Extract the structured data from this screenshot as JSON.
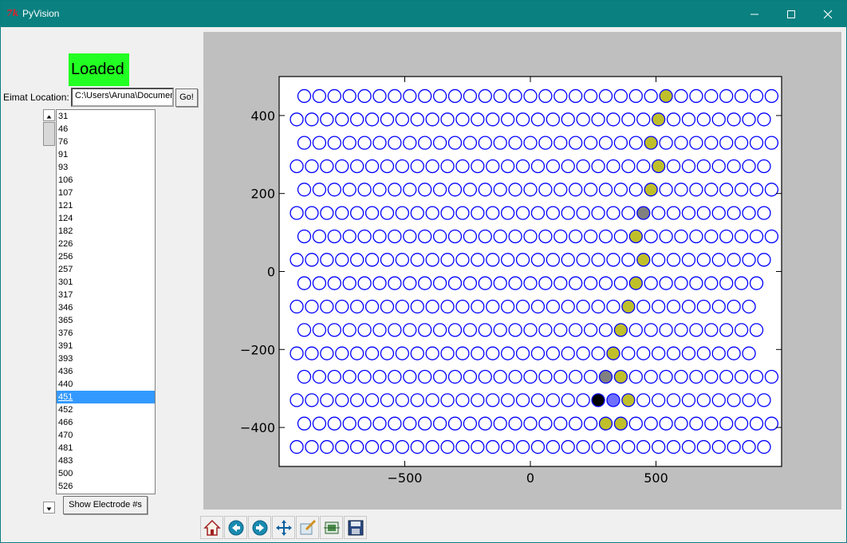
{
  "window": {
    "title": "PyVision",
    "icon": "tk-feather-icon"
  },
  "status": {
    "text": "Loaded",
    "color": "#22ff22"
  },
  "eimat": {
    "label": "Eimat Location:",
    "value": "C:\\Users\\Aruna\\Documents",
    "go_label": "Go!"
  },
  "electrode_list": {
    "items": [
      "31",
      "46",
      "76",
      "91",
      "93",
      "106",
      "107",
      "121",
      "124",
      "182",
      "226",
      "256",
      "257",
      "301",
      "317",
      "346",
      "365",
      "376",
      "391",
      "393",
      "436",
      "440",
      "451",
      "452",
      "466",
      "470",
      "481",
      "483",
      "500",
      "526"
    ],
    "selected": "451"
  },
  "show_button": {
    "label": "Show Electrode #s"
  },
  "chart_data": {
    "type": "scatter",
    "xlim": [
      -1000,
      1000
    ],
    "ylim": [
      -500,
      500
    ],
    "xticks": [
      -500,
      0,
      500
    ],
    "yticks": [
      400,
      200,
      0,
      -200,
      -400
    ],
    "xtick_labels": [
      "−500",
      "0",
      "500"
    ],
    "ytick_labels": [
      "400",
      "200",
      "0",
      "−200",
      "−400"
    ],
    "grid": false,
    "marker_edge_color": "#0000ff",
    "highlight_colors": {
      "olive": "#bfbf2a",
      "gray": "#808080",
      "black": "#000000",
      "blue": "#7070ff"
    },
    "rows": [
      {
        "y": 450,
        "x_start": -900,
        "count": 32
      },
      {
        "y": 390,
        "x_start": -930,
        "count": 32
      },
      {
        "y": 330,
        "x_start": -900,
        "count": 32
      },
      {
        "y": 270,
        "x_start": -930,
        "count": 32
      },
      {
        "y": 210,
        "x_start": -900,
        "count": 32
      },
      {
        "y": 150,
        "x_start": -930,
        "count": 32
      },
      {
        "y": 90,
        "x_start": -900,
        "count": 32
      },
      {
        "y": 30,
        "x_start": -930,
        "count": 32
      },
      {
        "y": -30,
        "x_start": -900,
        "count": 31
      },
      {
        "y": -90,
        "x_start": -930,
        "count": 31
      },
      {
        "y": -150,
        "x_start": -900,
        "count": 31
      },
      {
        "y": -210,
        "x_start": -930,
        "count": 31
      },
      {
        "y": -270,
        "x_start": -900,
        "count": 32
      },
      {
        "y": -330,
        "x_start": -930,
        "count": 32
      },
      {
        "y": -390,
        "x_start": -900,
        "count": 32
      },
      {
        "y": -450,
        "x_start": -930,
        "count": 32
      }
    ],
    "x_step": 60,
    "highlighted": [
      {
        "x": 540,
        "y": 450,
        "fill": "olive"
      },
      {
        "x": 510,
        "y": 390,
        "fill": "olive"
      },
      {
        "x": 480,
        "y": 330,
        "fill": "olive"
      },
      {
        "x": 510,
        "y": 270,
        "fill": "olive"
      },
      {
        "x": 480,
        "y": 210,
        "fill": "olive"
      },
      {
        "x": 450,
        "y": 150,
        "fill": "gray"
      },
      {
        "x": 420,
        "y": 90,
        "fill": "olive"
      },
      {
        "x": 450,
        "y": 30,
        "fill": "olive"
      },
      {
        "x": 420,
        "y": -30,
        "fill": "olive"
      },
      {
        "x": 390,
        "y": -90,
        "fill": "olive"
      },
      {
        "x": 360,
        "y": -150,
        "fill": "olive"
      },
      {
        "x": 330,
        "y": -210,
        "fill": "olive"
      },
      {
        "x": 300,
        "y": -270,
        "fill": "gray"
      },
      {
        "x": 360,
        "y": -270,
        "fill": "olive"
      },
      {
        "x": 270,
        "y": -330,
        "fill": "black"
      },
      {
        "x": 330,
        "y": -330,
        "fill": "blue"
      },
      {
        "x": 390,
        "y": -330,
        "fill": "olive"
      },
      {
        "x": 300,
        "y": -390,
        "fill": "olive"
      },
      {
        "x": 360,
        "y": -390,
        "fill": "olive"
      }
    ]
  },
  "toolbar": {
    "buttons": [
      {
        "name": "home-button",
        "icon": "home-icon"
      },
      {
        "name": "back-button",
        "icon": "arrow-left-icon"
      },
      {
        "name": "forward-button",
        "icon": "arrow-right-icon"
      },
      {
        "name": "pan-button",
        "icon": "move-icon"
      },
      {
        "name": "zoom-button",
        "icon": "zoom-rect-icon"
      },
      {
        "name": "subplots-button",
        "icon": "configure-subplots-icon"
      },
      {
        "name": "save-button",
        "icon": "save-icon"
      }
    ]
  }
}
